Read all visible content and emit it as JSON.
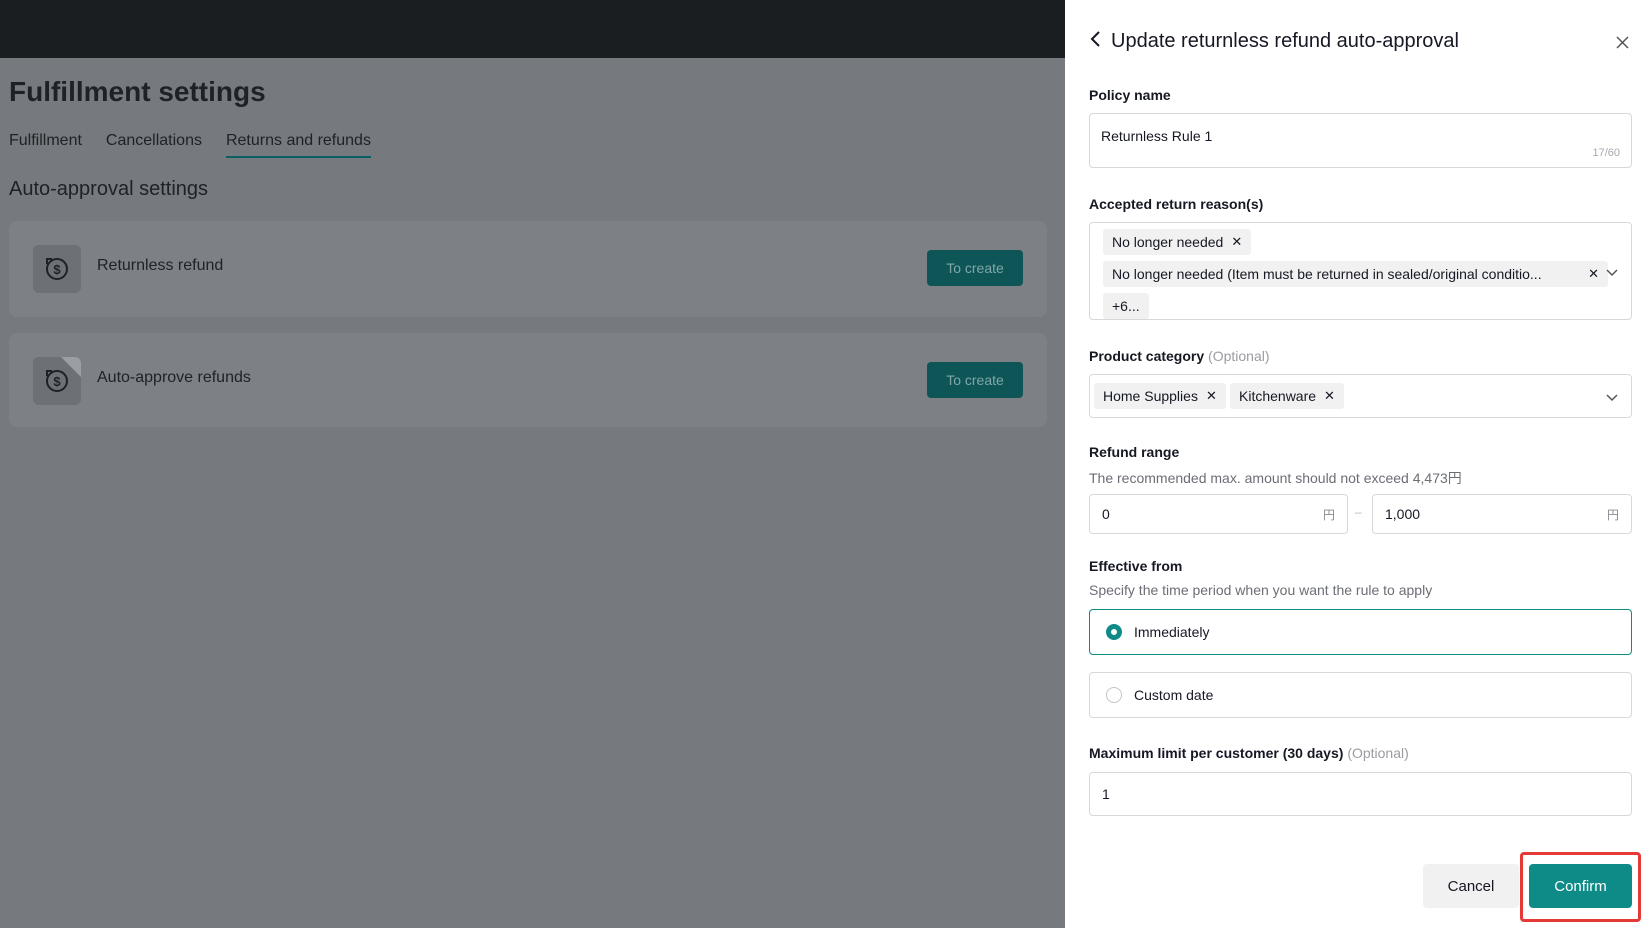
{
  "background": {
    "page_title": "Fulfillment settings",
    "tabs": [
      {
        "label": "Fulfillment",
        "active": false
      },
      {
        "label": "Cancellations",
        "active": false
      },
      {
        "label": "Returns and refunds",
        "active": true
      }
    ],
    "section_title": "Auto-approval settings",
    "cards": [
      {
        "label": "Returnless refund",
        "button": "To create",
        "icon": "dollar-refund-icon"
      },
      {
        "label": "Auto-approve refunds",
        "button": "To create",
        "icon": "dollar-refund-icon"
      }
    ]
  },
  "drawer": {
    "title": "Update returnless refund auto-approval",
    "policy_name": {
      "label": "Policy name",
      "value": "Returnless Rule 1",
      "count": "17/60"
    },
    "return_reasons": {
      "label": "Accepted return reason(s)",
      "tags": [
        "No longer needed",
        "No longer needed (Item must be returned in sealed/original conditio...",
        "+6..."
      ]
    },
    "product_category": {
      "label": "Product category",
      "optional": "(Optional)",
      "tags": [
        "Home Supplies",
        "Kitchenware"
      ]
    },
    "refund_range": {
      "label": "Refund range",
      "hint": "The recommended max. amount should not exceed 4,473円",
      "min": "0",
      "max": "1,000",
      "currency": "円",
      "separator": "–"
    },
    "effective_from": {
      "label": "Effective from",
      "hint": "Specify the time period when you want the rule to apply",
      "options": [
        {
          "label": "Immediately",
          "selected": true
        },
        {
          "label": "Custom date",
          "selected": false
        }
      ]
    },
    "max_limit": {
      "label": "Maximum limit per customer (30 days)",
      "optional": "(Optional)",
      "value": "1"
    },
    "buttons": {
      "cancel": "Cancel",
      "confirm": "Confirm"
    }
  },
  "colors": {
    "accent": "#0e8b86",
    "highlight": "#e53935",
    "topbar": "#1b1e21"
  }
}
